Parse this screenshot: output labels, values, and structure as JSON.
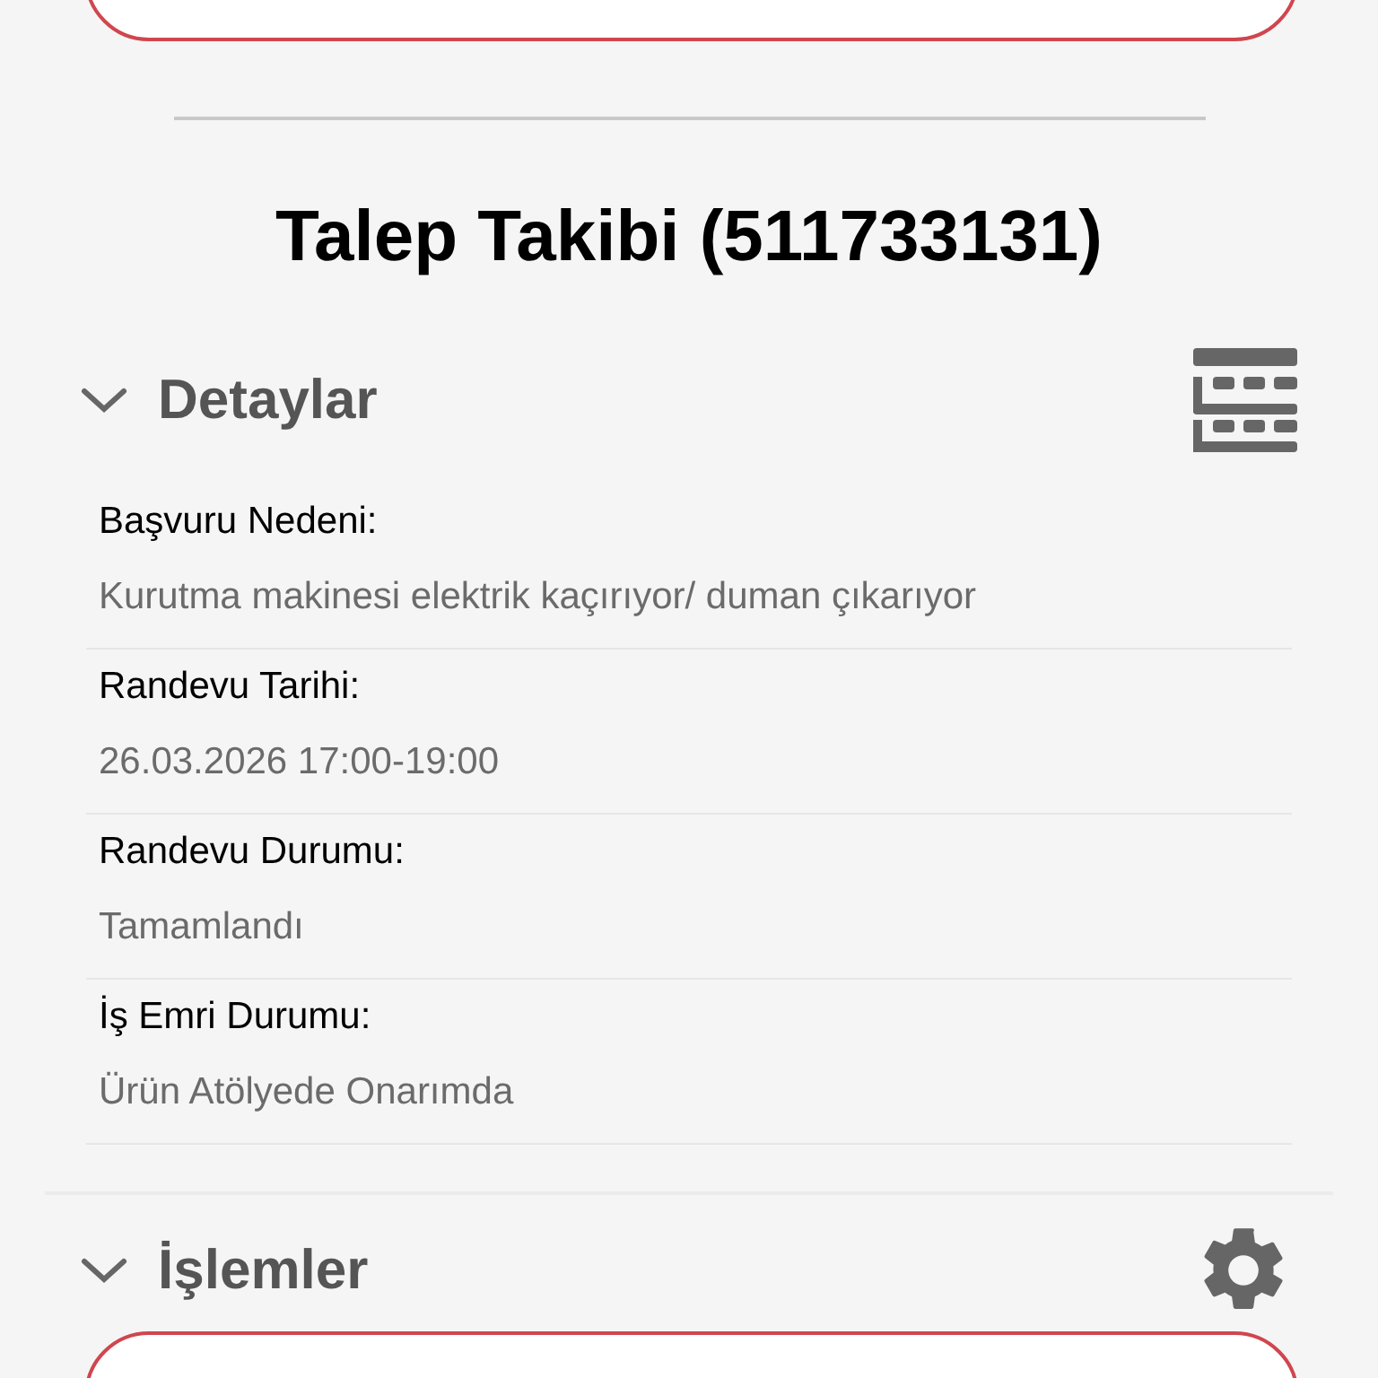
{
  "title": "Talep Takibi (511733131)",
  "sections": [
    {
      "kind": "details",
      "title": "Detaylar",
      "expanded": true,
      "fields": [
        {
          "label": "Başvuru Nedeni:",
          "value": "Kurutma makinesi elektrik kaçırıyor/ duman çıkarıyor"
        },
        {
          "label": "Randevu Tarihi:",
          "value": "26.03.2026 17:00-19:00"
        },
        {
          "label": "Randevu Durumu:",
          "value": "Tamamlandı"
        },
        {
          "label": "İş Emri Durumu:",
          "value": "Ürün Atölyede Onarımda"
        }
      ]
    },
    {
      "kind": "actions",
      "title": "İşlemler",
      "expanded": true
    }
  ]
}
